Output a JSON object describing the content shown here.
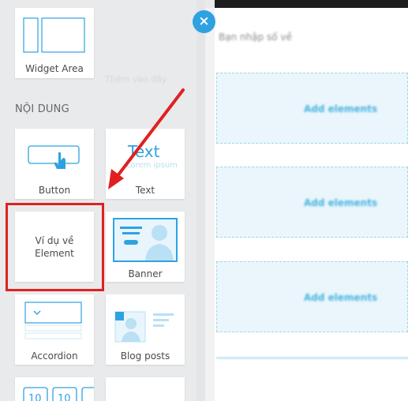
{
  "panel": {
    "section_title": "NỘI DUNG",
    "faded_hint": "Thêm vào đây",
    "widgets": [
      {
        "label": "Widget Area"
      },
      {
        "label": "Button"
      },
      {
        "label": "Text",
        "preview_title": "Text",
        "preview_sub": "Lorem ipsum"
      },
      {
        "label": "Ví dụ về Element"
      },
      {
        "label": "Banner"
      },
      {
        "label": "Accordion"
      },
      {
        "label": "Blog posts"
      },
      {
        "label": "",
        "preview": "10 10"
      },
      {
        "label": ""
      }
    ]
  },
  "editor": {
    "blur_text": "Bạn nhập số về",
    "rows": [
      {
        "label": "Add elements"
      },
      {
        "label": "Add elements"
      },
      {
        "label": "Add elements"
      }
    ]
  },
  "close_label": "×",
  "colors": {
    "accent": "#2ea2e1",
    "annotation": "#e02020",
    "panel_bg": "#e9eaeb"
  }
}
